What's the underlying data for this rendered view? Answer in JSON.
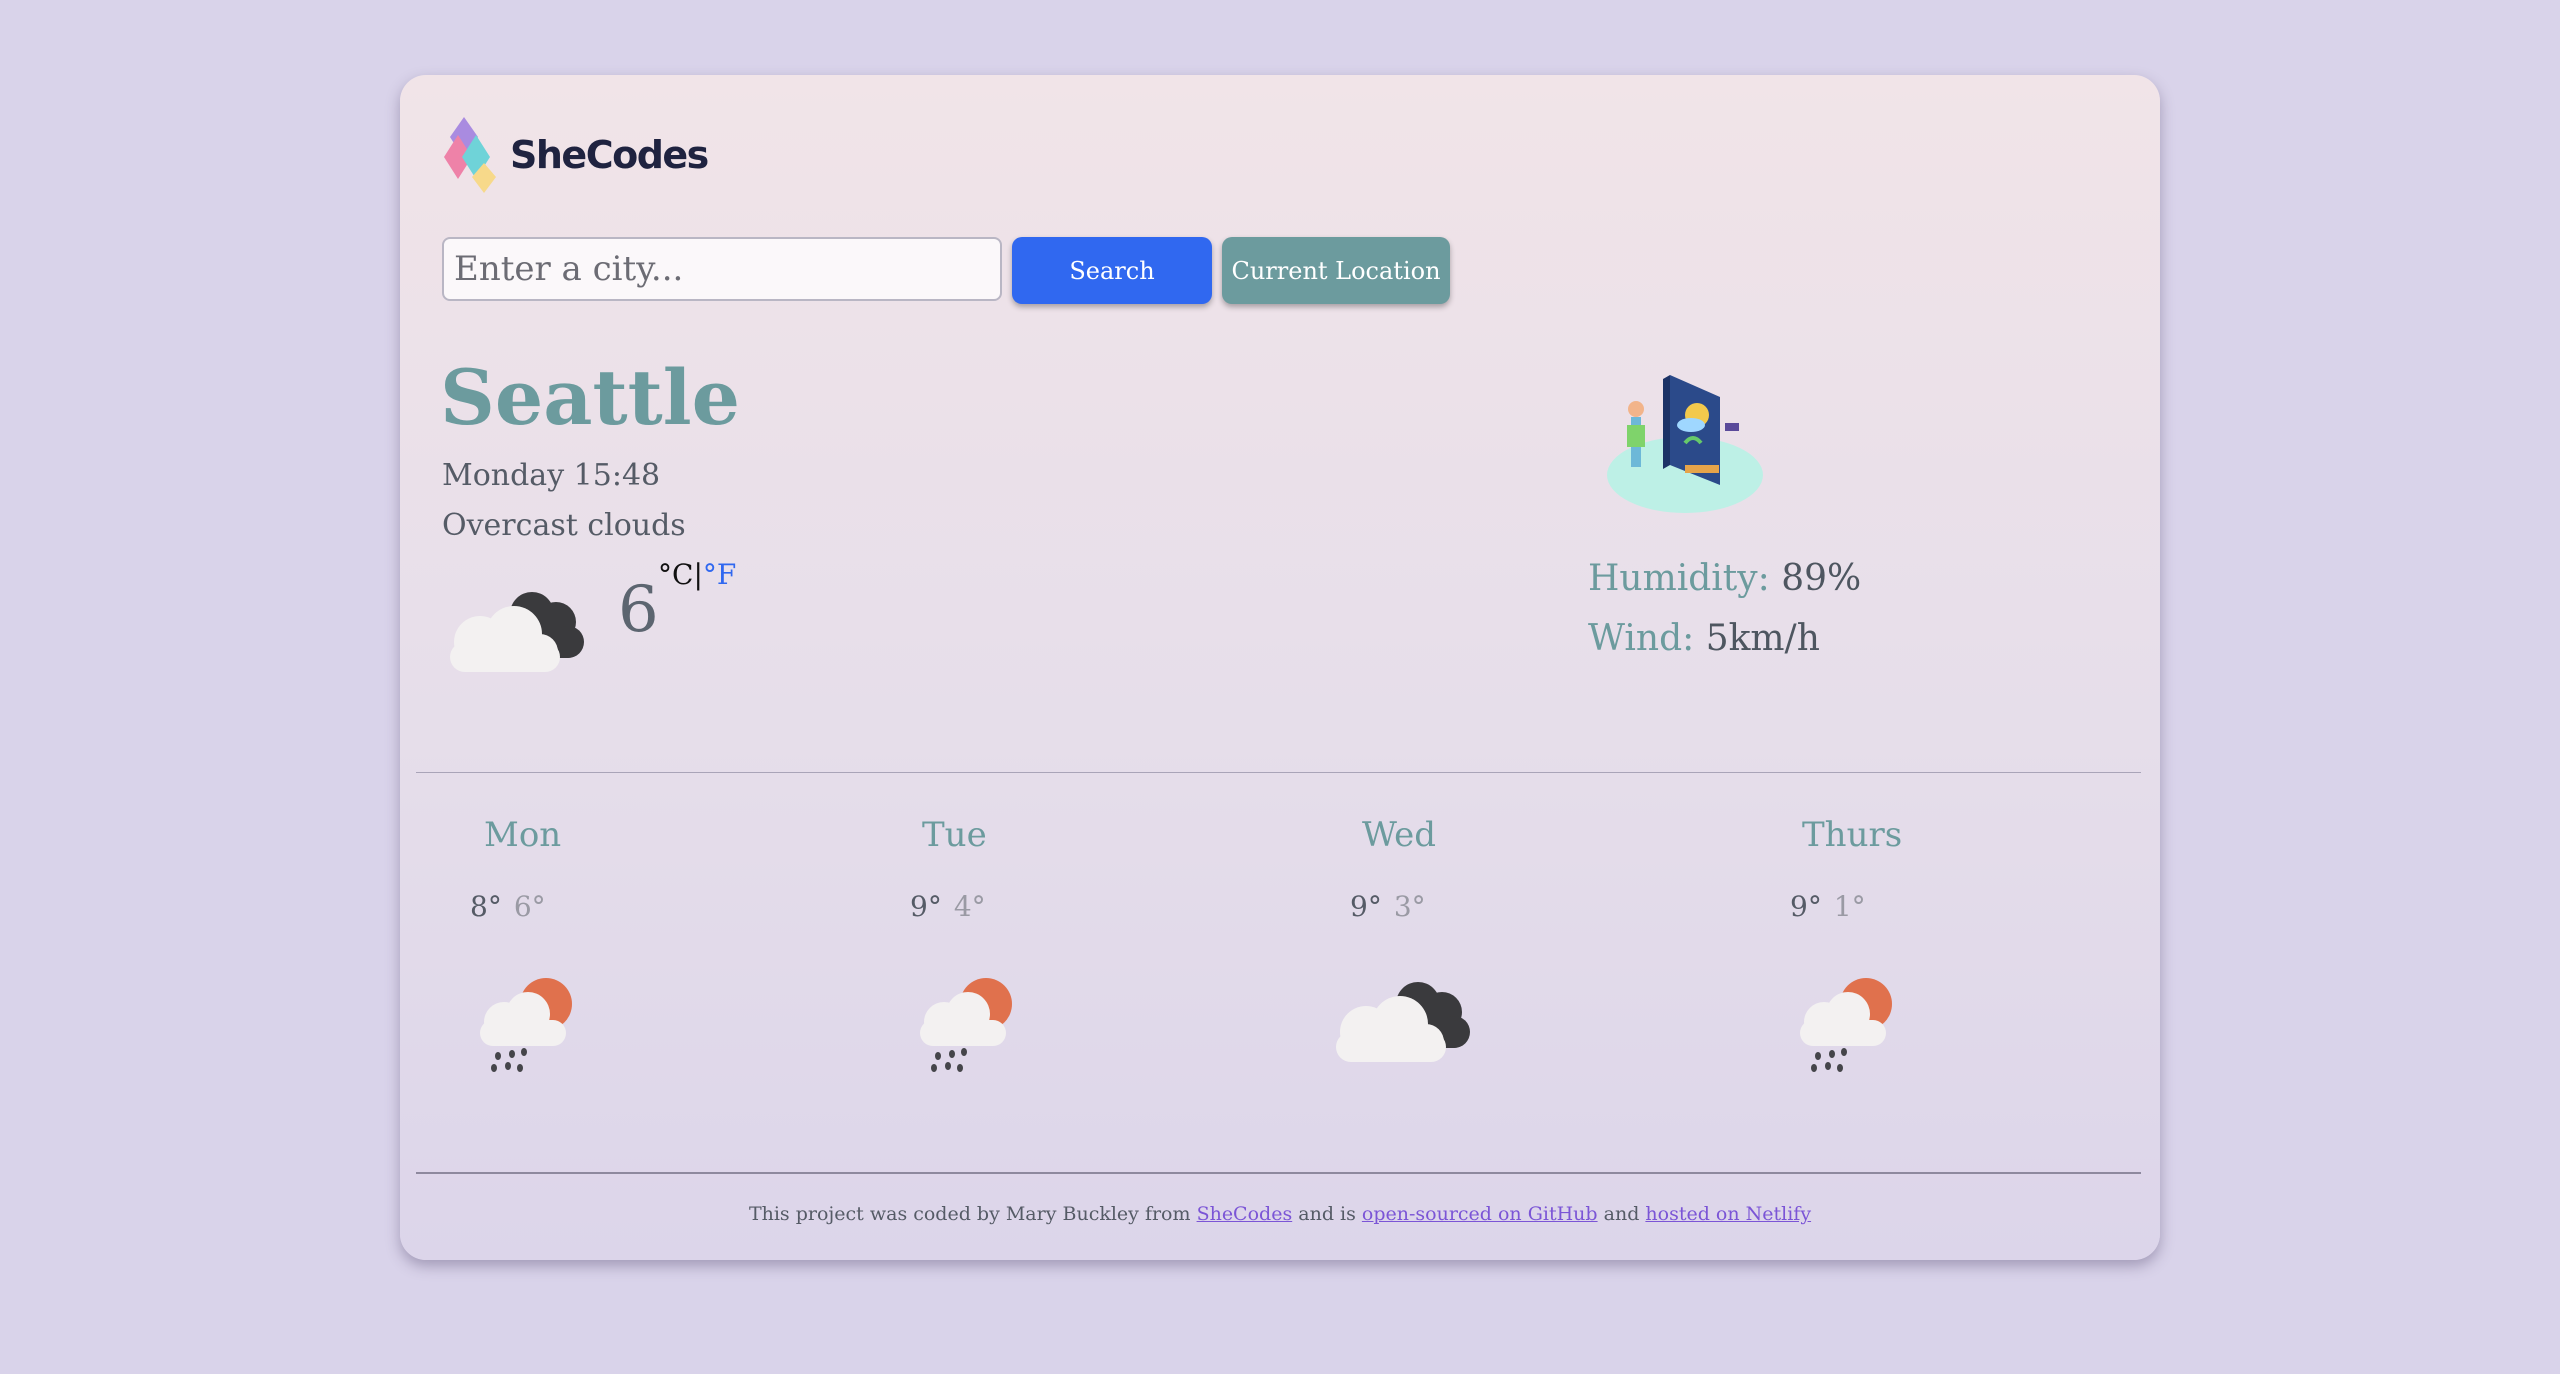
{
  "brand": {
    "name": "SheCodes"
  },
  "search": {
    "placeholder": "Enter a city...",
    "search_label": "Search",
    "location_label": "Current Location"
  },
  "current": {
    "city": "Seattle",
    "datetime": "Monday 15:48",
    "description": "Overcast clouds",
    "temperature": "6",
    "unit_c": "°C",
    "unit_sep": "|",
    "unit_f": "°F",
    "humidity_label": "Humidity:",
    "humidity_value": "89%",
    "wind_label": "Wind:",
    "wind_value": "5km/h",
    "icon": "overcast-clouds-icon"
  },
  "forecast": [
    {
      "day": "Mon",
      "max": "8°",
      "min": "6°",
      "icon": "rain-sun-icon"
    },
    {
      "day": "Tue",
      "max": "9°",
      "min": "4°",
      "icon": "rain-sun-icon"
    },
    {
      "day": "Wed",
      "max": "9°",
      "min": "3°",
      "icon": "overcast-clouds-icon"
    },
    {
      "day": "Thurs",
      "max": "9°",
      "min": "1°",
      "icon": "rain-sun-icon"
    }
  ],
  "footer": {
    "prefix": "This project was coded by Mary Buckley from",
    "link1": "SheCodes",
    "mid1": "and is",
    "link2": "open-sourced on GitHub",
    "mid2": "and",
    "link3": "hosted on Netlify"
  },
  "colors": {
    "background": "#d9d3ea",
    "accent_teal": "#6c9b9e",
    "search_blue": "#3068f0",
    "link_purple": "#7b55d6"
  }
}
